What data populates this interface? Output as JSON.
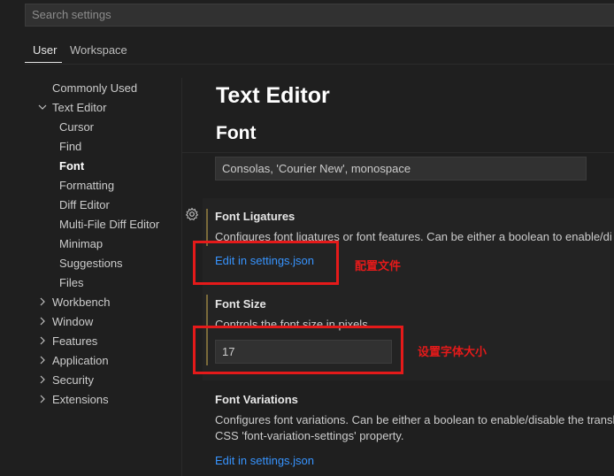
{
  "search": {
    "placeholder": "Search settings"
  },
  "tabs": [
    "User",
    "Workspace"
  ],
  "toc": {
    "commonly_used": "Commonly Used",
    "text_editor": "Text Editor",
    "text_editor_children": [
      "Cursor",
      "Find",
      "Font",
      "Formatting",
      "Diff Editor",
      "Multi-File Diff Editor",
      "Minimap",
      "Suggestions",
      "Files"
    ],
    "groups": [
      "Workbench",
      "Window",
      "Features",
      "Application",
      "Security",
      "Extensions"
    ]
  },
  "header": {
    "title": "Text Editor",
    "section": "Font"
  },
  "settings": {
    "font_family_value": "Consolas, 'Courier New', monospace",
    "ligatures": {
      "title": "Font Ligatures",
      "desc": "Configures font ligatures or font features. Can be either a boolean to enable/di",
      "link": "Edit in settings.json"
    },
    "font_size": {
      "title": "Font Size",
      "desc": "Controls the font size in pixels.",
      "value": "17"
    },
    "variations": {
      "title": "Font Variations",
      "desc1": "Configures font variations. Can be either a boolean to enable/disable the transl",
      "desc2": "CSS 'font-variation-settings' property.",
      "link": "Edit in settings.json"
    }
  },
  "annotations": {
    "config_file": "配置文件",
    "set_font_size": "设置字体大小"
  },
  "colors": {
    "accent_link": "#3794ff",
    "annotation_red": "#e51a1a",
    "modified_bar": "#7a6a3a"
  },
  "icons": {
    "gear": "gear-icon",
    "chevron_down": "chevron-down-icon",
    "chevron_right": "chevron-right-icon"
  }
}
